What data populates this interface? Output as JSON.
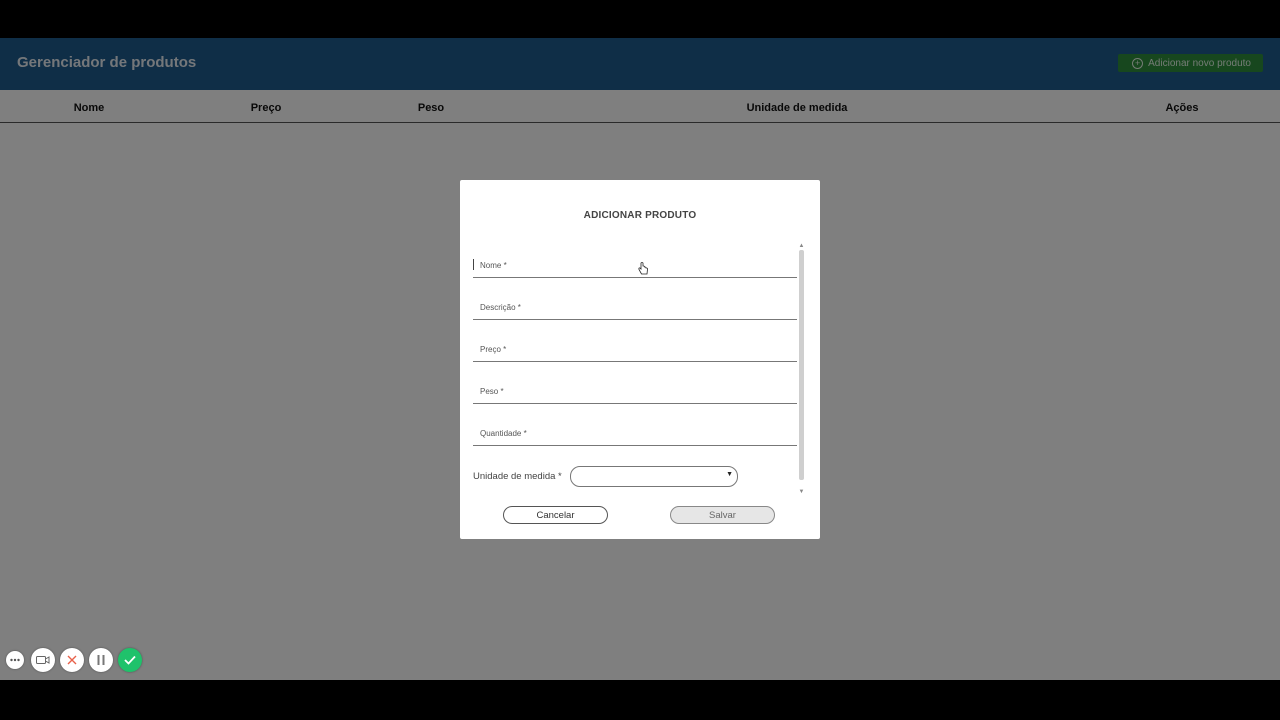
{
  "header": {
    "title": "Gerenciador de produtos",
    "add_button_label": "Adicionar novo produto"
  },
  "table": {
    "columns": [
      "Nome",
      "Preço",
      "Peso",
      "Unidade de medida",
      "Ações"
    ]
  },
  "modal": {
    "title": "ADICIONAR PRODUTO",
    "fields": [
      {
        "label": "Nome *",
        "value": ""
      },
      {
        "label": "Descrição *",
        "value": ""
      },
      {
        "label": "Preço *",
        "value": ""
      },
      {
        "label": "Peso *",
        "value": ""
      },
      {
        "label": "Quantidade *",
        "value": ""
      }
    ],
    "unit_label": "Unidade de medida *",
    "unit_selected": "",
    "cancel_label": "Cancelar",
    "save_label": "Salvar"
  },
  "recorder": {
    "icons": [
      "more-icon",
      "camera-icon",
      "close-icon",
      "pause-icon",
      "check-icon"
    ]
  },
  "colors": {
    "header_bg": "#1f5d8f",
    "add_button_bg": "#2e8f3c",
    "confirm_green": "#1fc26b"
  }
}
